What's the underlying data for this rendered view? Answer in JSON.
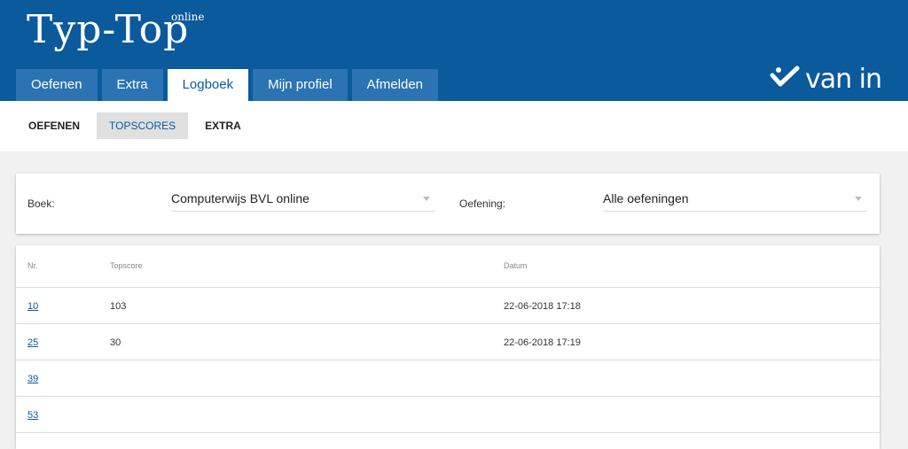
{
  "header": {
    "logo": "Typ-Top",
    "logo_sup": "online",
    "tabs": [
      {
        "label": "Oefenen",
        "active": false
      },
      {
        "label": "Extra",
        "active": false
      },
      {
        "label": "Logboek",
        "active": true
      },
      {
        "label": "Mijn profiel",
        "active": false
      },
      {
        "label": "Afmelden",
        "active": false
      }
    ],
    "brand": "van in",
    "brand_icon": "checkmark-heart-icon"
  },
  "subnav": {
    "tabs": [
      {
        "label": "OEFENEN",
        "active": false
      },
      {
        "label": "TOPSCORES",
        "active": true
      },
      {
        "label": "EXTRA",
        "active": false
      }
    ]
  },
  "filters": {
    "boek_label": "Boek:",
    "boek_value": "Computerwijs BVL online",
    "oefening_label": "Oefening:",
    "oefening_value": "Alle oefeningen"
  },
  "table": {
    "headers": [
      "Nr.",
      "Topscore",
      "Datum"
    ],
    "rows": [
      {
        "nr": "10",
        "topscore": "103",
        "datum": "22-06-2018 17:18"
      },
      {
        "nr": "25",
        "topscore": "30",
        "datum": "22-06-2018 17:19"
      },
      {
        "nr": "39",
        "topscore": "",
        "datum": ""
      },
      {
        "nr": "53",
        "topscore": "",
        "datum": ""
      }
    ]
  },
  "colors": {
    "header_bg": "#0a5a9c",
    "tab_bg": "#2b73b2",
    "page_bg": "#f1f1f1"
  }
}
